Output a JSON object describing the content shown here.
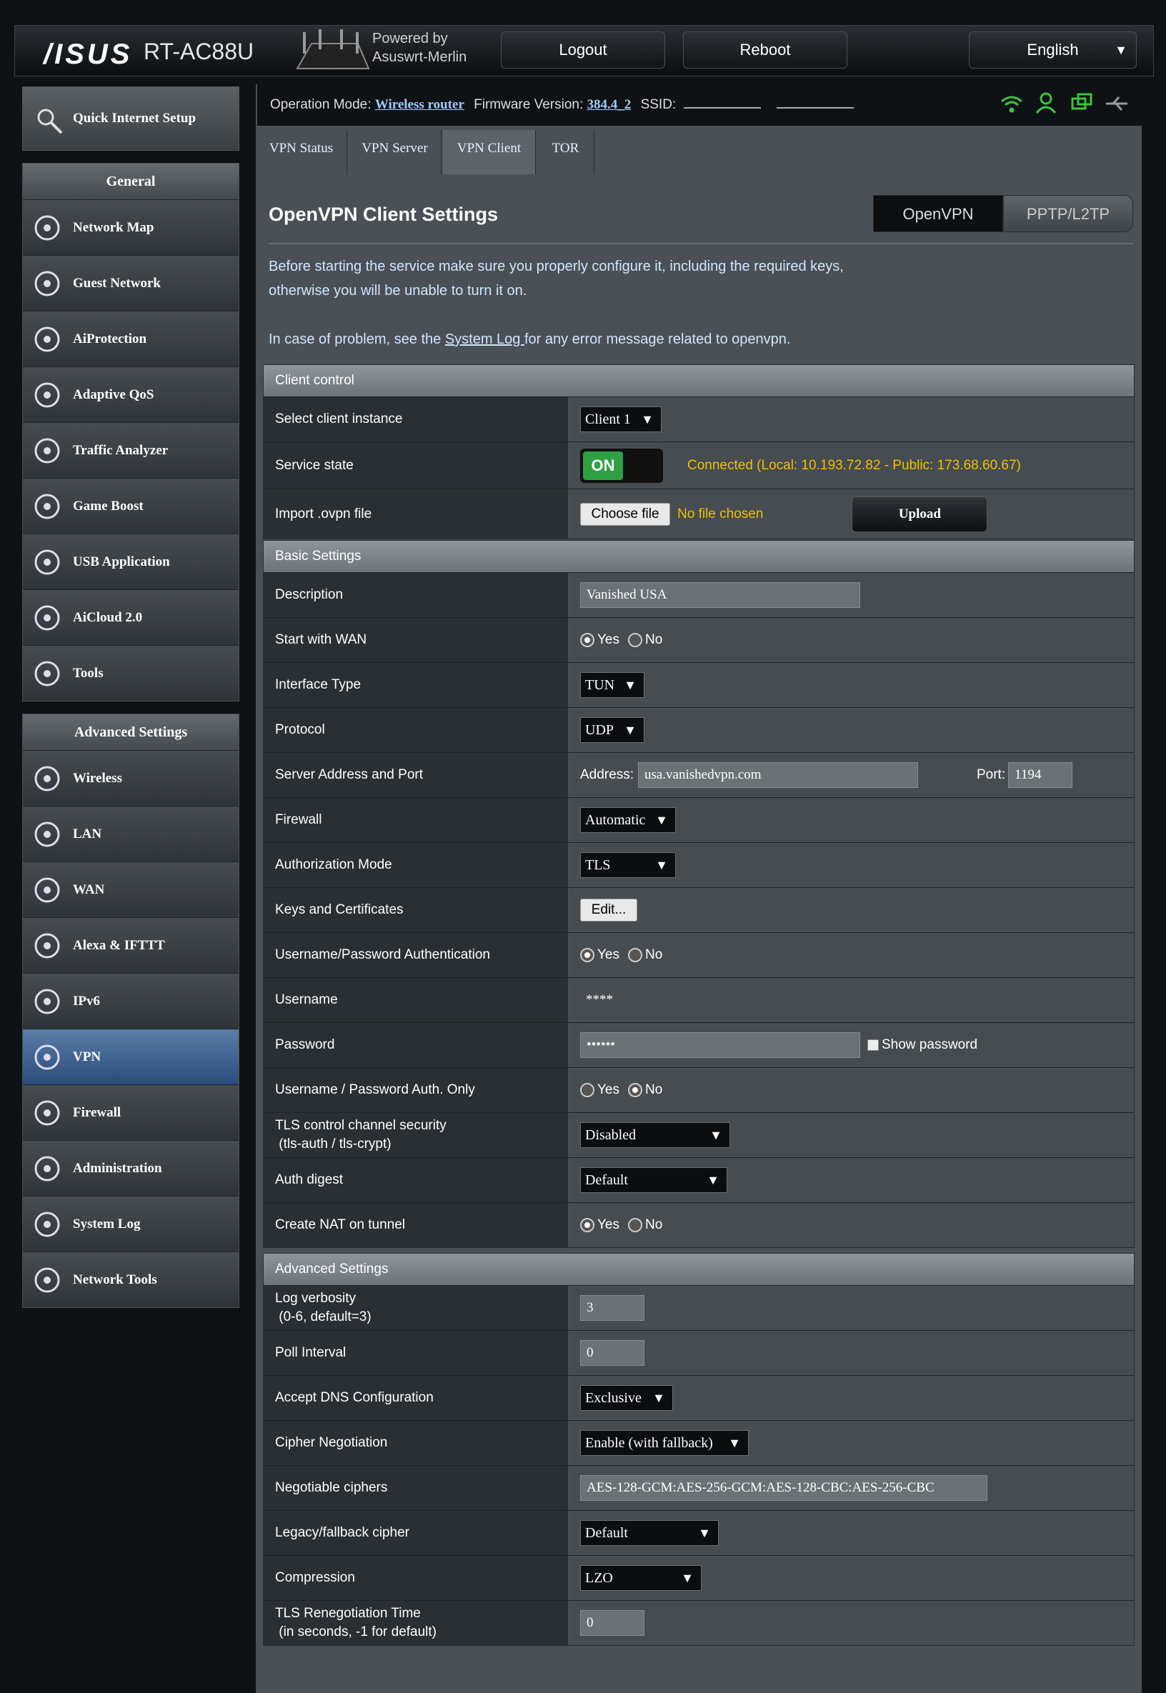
{
  "header": {
    "brand": "/ISUS",
    "model": "RT-AC88U",
    "powered_line1": "Powered by",
    "powered_line2": "Asuswrt-Merlin",
    "logout": "Logout",
    "reboot": "Reboot",
    "language": "English"
  },
  "infobar": {
    "op_label": "Operation Mode:",
    "op_value": "Wireless router",
    "fw_label": "Firmware Version:",
    "fw_value": "384.4_2",
    "ssid_label": "SSID:"
  },
  "sidebar": {
    "qis": "Quick Internet Setup",
    "general_title": "General",
    "general": [
      {
        "label": "Network Map"
      },
      {
        "label": "Guest Network"
      },
      {
        "label": "AiProtection"
      },
      {
        "label": "Adaptive QoS"
      },
      {
        "label": "Traffic Analyzer"
      },
      {
        "label": "Game Boost"
      },
      {
        "label": "USB Application"
      },
      {
        "label": "AiCloud 2.0"
      },
      {
        "label": "Tools"
      }
    ],
    "advanced_title": "Advanced Settings",
    "advanced": [
      {
        "label": "Wireless"
      },
      {
        "label": "LAN"
      },
      {
        "label": "WAN"
      },
      {
        "label": "Alexa & IFTTT"
      },
      {
        "label": "IPv6"
      },
      {
        "label": "VPN"
      },
      {
        "label": "Firewall"
      },
      {
        "label": "Administration"
      },
      {
        "label": "System Log"
      },
      {
        "label": "Network Tools"
      }
    ]
  },
  "tabs": [
    {
      "label": "VPN Status"
    },
    {
      "label": "VPN Server"
    },
    {
      "label": "VPN Client"
    },
    {
      "label": "TOR"
    }
  ],
  "page": {
    "title": "OpenVPN Client Settings",
    "btn_openvpn": "OpenVPN",
    "btn_pptp": "PPTP/L2TP",
    "intro1": "Before starting the service make sure you properly configure it, including the required keys,",
    "intro2": "otherwise you will be unable to turn it on.",
    "problem_pre": "In case of problem, see the ",
    "problem_link": "System Log ",
    "problem_post": "for any error message related to openvpn."
  },
  "client_control": {
    "header": "Client control",
    "instance_label": "Select client instance",
    "instance_value": "Client 1",
    "state_label": "Service state",
    "state_on": "ON",
    "state_status": "Connected (Local: 10.193.72.82 - Public: 173.68.60.67)",
    "import_label": "Import .ovpn file",
    "choose_file": "Choose file",
    "no_file": "No file chosen",
    "upload": "Upload"
  },
  "basic": {
    "header": "Basic Settings",
    "description_label": "Description",
    "description_value": "Vanished USA",
    "start_wan_label": "Start with WAN",
    "iface_label": "Interface Type",
    "iface_value": "TUN",
    "proto_label": "Protocol",
    "proto_value": "UDP",
    "server_label": "Server Address and Port",
    "address_label": "Address:",
    "address_value": "usa.vanishedvpn.com",
    "port_label": "Port:",
    "port_value": "1194",
    "firewall_label": "Firewall",
    "firewall_value": "Automatic",
    "authmode_label": "Authorization Mode",
    "authmode_value": "TLS",
    "keys_label": "Keys and Certificates",
    "keys_btn": "Edit...",
    "upauth_label": "Username/Password Authentication",
    "username_label": "Username",
    "username_value": "****",
    "password_label": "Password",
    "password_value": "••••••",
    "show_password": "Show password",
    "uponly_label": "Username / Password Auth. Only",
    "tls_label1": "TLS control channel security",
    "tls_label2": " (tls-auth / tls-crypt)",
    "tls_value": "Disabled",
    "digest_label": "Auth digest",
    "digest_value": "Default",
    "nat_label": "Create NAT on tunnel",
    "yes": "Yes",
    "no": "No"
  },
  "advanced": {
    "header": "Advanced Settings",
    "verb_label1": "Log verbosity",
    "verb_label2": " (0-6, default=3)",
    "verb_value": "3",
    "poll_label": "Poll Interval",
    "poll_value": "0",
    "dns_label": "Accept DNS Configuration",
    "dns_value": "Exclusive",
    "cipher_neg_label": "Cipher Negotiation",
    "cipher_neg_value": "Enable (with fallback)",
    "ciphers_label": "Negotiable ciphers",
    "ciphers_value": "AES-128-GCM:AES-256-GCM:AES-128-CBC:AES-256-CBC",
    "legacy_label": "Legacy/fallback cipher",
    "legacy_value": "Default",
    "comp_label": "Compression",
    "comp_value": "LZO",
    "reneg_label1": "TLS Renegotiation Time",
    "reneg_label2": " (in seconds, -1 for default)",
    "reneg_value": "0"
  },
  "colors": {
    "accent": "#5b7da6",
    "status": "#f0c000",
    "on_green": "#2ea043"
  }
}
